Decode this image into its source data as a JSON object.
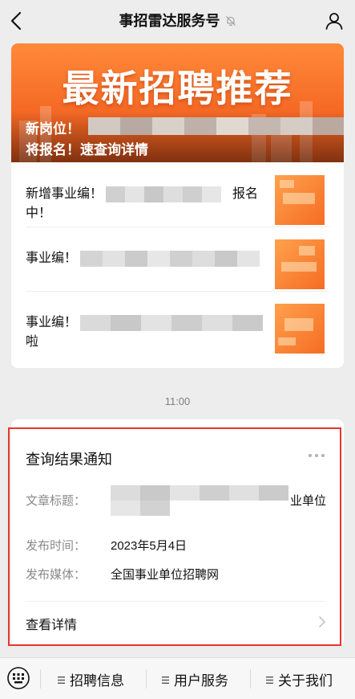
{
  "header": {
    "title": "事招雷达服务号"
  },
  "article": {
    "banner_headline": "最新招聘推荐",
    "banner_line1": "新岗位！",
    "banner_line2": "将报名！速查询详情",
    "items": [
      {
        "text_part1": "新增事业编！",
        "text_part2": "报名",
        "text_part3": "中！"
      },
      {
        "text_part1": "事业编！"
      },
      {
        "text_part1": "事业编！",
        "text_part3": "啦"
      }
    ]
  },
  "chat": {
    "time": "11:00"
  },
  "notice": {
    "title": "查询结果通知",
    "fields": [
      {
        "label": "文章标题：",
        "value_tail": "业单位"
      },
      {
        "label": "发布时间：",
        "value": "2023年5月4日"
      },
      {
        "label": "发布媒体：",
        "value": "全国事业单位招聘网"
      }
    ],
    "detail_link": "查看详情"
  },
  "menu": {
    "items": [
      {
        "label": "招聘信息"
      },
      {
        "label": "用户服务"
      },
      {
        "label": "关于我们"
      }
    ]
  },
  "colors": {
    "accent_orange": "#f56a25",
    "highlight_red": "#e7362f",
    "page_bg": "#ededed"
  }
}
